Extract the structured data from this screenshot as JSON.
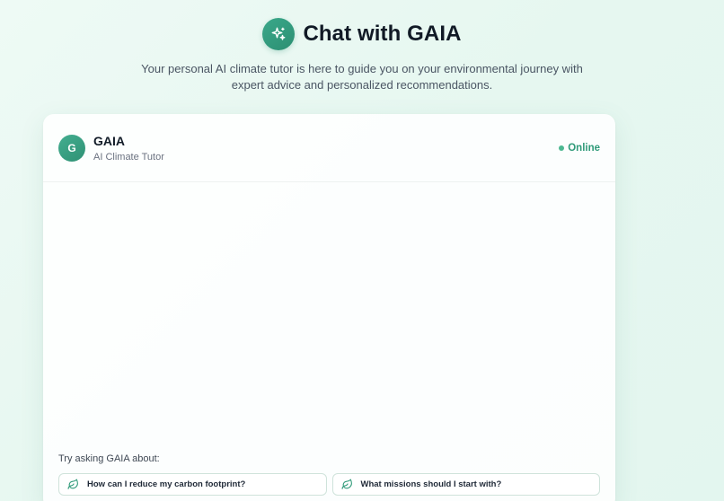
{
  "header": {
    "title": "Chat with GAIA",
    "icon": "sparkles-icon",
    "subtitle_line1": "Your personal AI climate tutor is here to guide you on your environmental journey with",
    "subtitle_line2": "expert advice and personalized recommendations."
  },
  "chat": {
    "avatar_initial": "G",
    "agent_name": "GAIA",
    "agent_role": "AI Climate Tutor",
    "status": "Online",
    "status_color": "#2f9a79",
    "suggest_label": "Try asking GAIA about:",
    "suggestions": [
      {
        "label": "How can I reduce my carbon footprint?",
        "icon": "leaf-icon"
      },
      {
        "label": "What missions should I start with?",
        "icon": "leaf-icon"
      }
    ]
  },
  "colors": {
    "accent": "#2f9174",
    "background": "#e6f7f0"
  }
}
